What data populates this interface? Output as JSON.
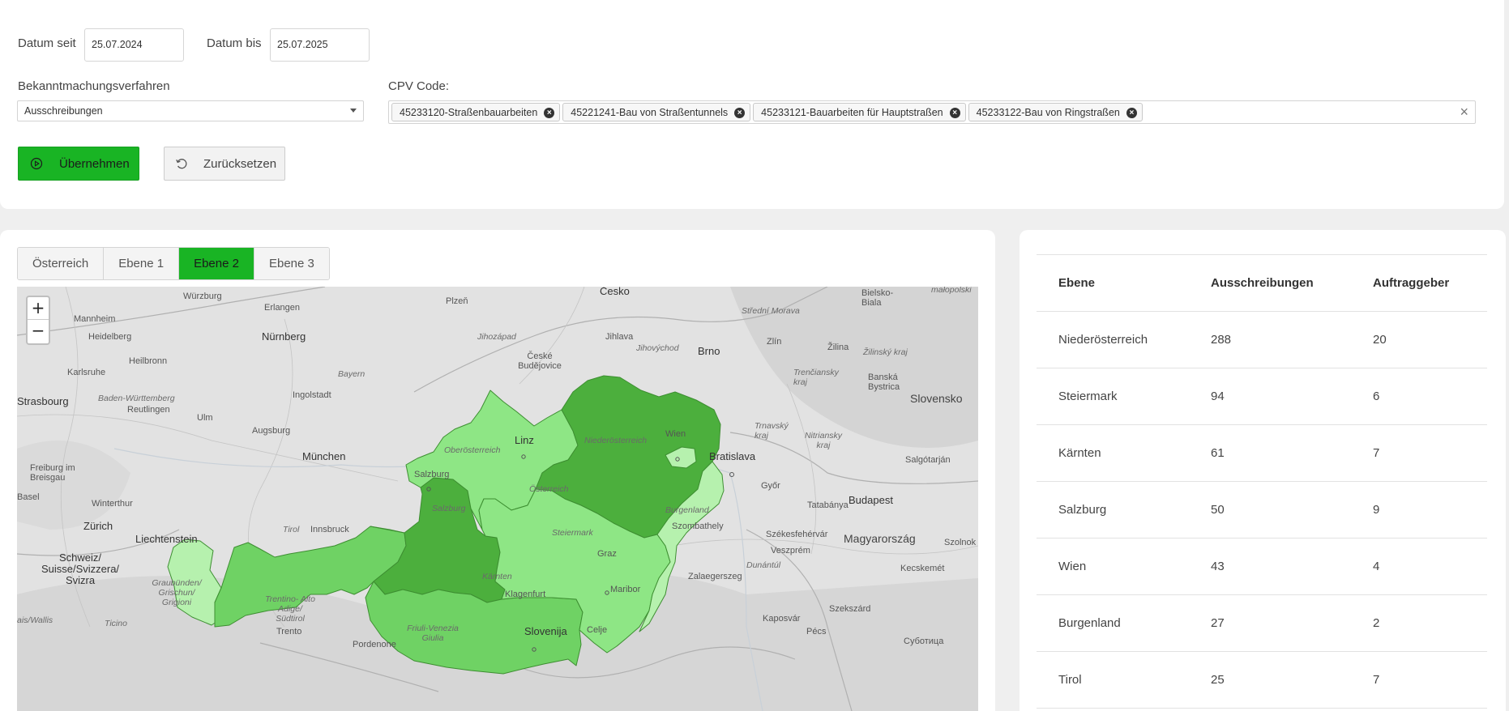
{
  "filters": {
    "date_from_label": "Datum seit",
    "date_from_value": "25.07.2024",
    "date_to_label": "Datum bis",
    "date_to_value": "25.07.2025",
    "procedure_label": "Bekanntmachungsverfahren",
    "procedure_value": "Ausschreibungen",
    "cpv_label": "CPV Code:",
    "cpv_tags": [
      "45233120-Straßenbauarbeiten",
      "45221241-Bau von Straßentunnels",
      "45233121-Bauarbeiten für Hauptstraßen",
      "45233122-Bau von Ringstraßen"
    ],
    "apply_label": "Übernehmen",
    "reset_label": "Zurücksetzen"
  },
  "tabs": [
    "Österreich",
    "Ebene 1",
    "Ebene 2",
    "Ebene 3"
  ],
  "active_tab": "Ebene 2",
  "map": {
    "zoom_in": "+",
    "zoom_out": "−",
    "region_colors": {
      "dark": "#4caf3d",
      "medium": "#6fd264",
      "light": "#8ee685",
      "pale": "#b6f1ae"
    },
    "labels": {
      "cesko": "Česko",
      "wurzburg": "Würzburg",
      "erlangen": "Erlangen",
      "plzen": "Plzeň",
      "mannheim": "Mannheim",
      "nurnberg": "Nürnberg",
      "heidelberg": "Heidelberg",
      "jihozapad": "Jihozápad",
      "jihlava": "Jihlava",
      "jihovychod": "Jihovýchod",
      "brno": "Brno",
      "stredni_morava": "Střední Morava",
      "bielsko": "Bielsko-Biala",
      "malopolska": "małopolski",
      "zlin": "Zlín",
      "zilina": "Žilina",
      "zilinsky": "Žilinský kraj",
      "heilbronn": "Heilbronn",
      "ceske_budejovice": "České Budějovice",
      "karlsruhe": "Karlsruhe",
      "bayern": "Bayern",
      "trencin": "Trenčiansky kraj",
      "banska": "Banská Bystrica",
      "strasbourg": "Strasbourg",
      "baden": "Baden-Württemberg",
      "ingolstadt": "Ingolstadt",
      "slovensko": "Slovensko",
      "reutlingen": "Reutlingen",
      "ulm": "Ulm",
      "linz": "Linz",
      "trnava": "Trnavský kraj",
      "nitra": "Nitriansky kraj",
      "wien": "Wien",
      "augsburg": "Augsburg",
      "oberosterreich": "Oberösterreich",
      "niederosterreich": "Niederösterreich",
      "bratislava": "Bratislava",
      "munchen": "München",
      "freiburg": "Freiburg im Breisgau",
      "salgotarjan": "Salgótarján",
      "salzburg_city": "Salzburg",
      "osterreich": "Österreich",
      "gyor": "Győr",
      "budapest": "Budapest",
      "basel": "Basel",
      "winterthur": "Winterthur",
      "salzburg_state": "Salzburg",
      "burgenland": "Burgenland",
      "tatabanya": "Tatabánya",
      "zurich": "Zürich",
      "liechtenstein": "Liechtenstein",
      "tirol": "Tirol",
      "innsbruck": "Innsbruck",
      "steiermark": "Steiermark",
      "szombathely": "Szombathely",
      "szekesfehervar": "Székesfehérvár",
      "magyarorszag": "Magyarország",
      "szolnok": "Szolnok",
      "schweiz": "Schweiz/ Suisse/Svizzera/ Svizra",
      "graz": "Graz",
      "veszprem": "Veszprém",
      "dunantul": "Dunántúl",
      "kecskemet": "Kecskemét",
      "graubunden": "Graubünden/ Grischun/ Grigioni",
      "karnten": "Kärnten",
      "zalaegerszeg": "Zalaegerszeg",
      "maribor": "Maribor",
      "klagenfurt": "Klagenfurt",
      "trentino": "Trentino- Alto Adige/ Südtirol",
      "szekszard": "Szekszárd",
      "ticino": "Ticino",
      "kaposvar": "Kaposvár",
      "friuli": "Friuli-Venezia Giulia",
      "slovenija": "Slovenija",
      "celje": "Celje",
      "pecs": "Pécs",
      "trento": "Trento",
      "pordenone": "Pordenone",
      "subotica": "Суботица",
      "lais": "ais/Wallis"
    }
  },
  "table": {
    "headers": [
      "Ebene",
      "Ausschreibungen",
      "Auftraggeber"
    ],
    "rows": [
      [
        "Niederösterreich",
        "288",
        "20"
      ],
      [
        "Steiermark",
        "94",
        "6"
      ],
      [
        "Kärnten",
        "61",
        "7"
      ],
      [
        "Salzburg",
        "50",
        "9"
      ],
      [
        "Wien",
        "43",
        "4"
      ],
      [
        "Burgenland",
        "27",
        "2"
      ],
      [
        "Tirol",
        "25",
        "7"
      ]
    ]
  }
}
